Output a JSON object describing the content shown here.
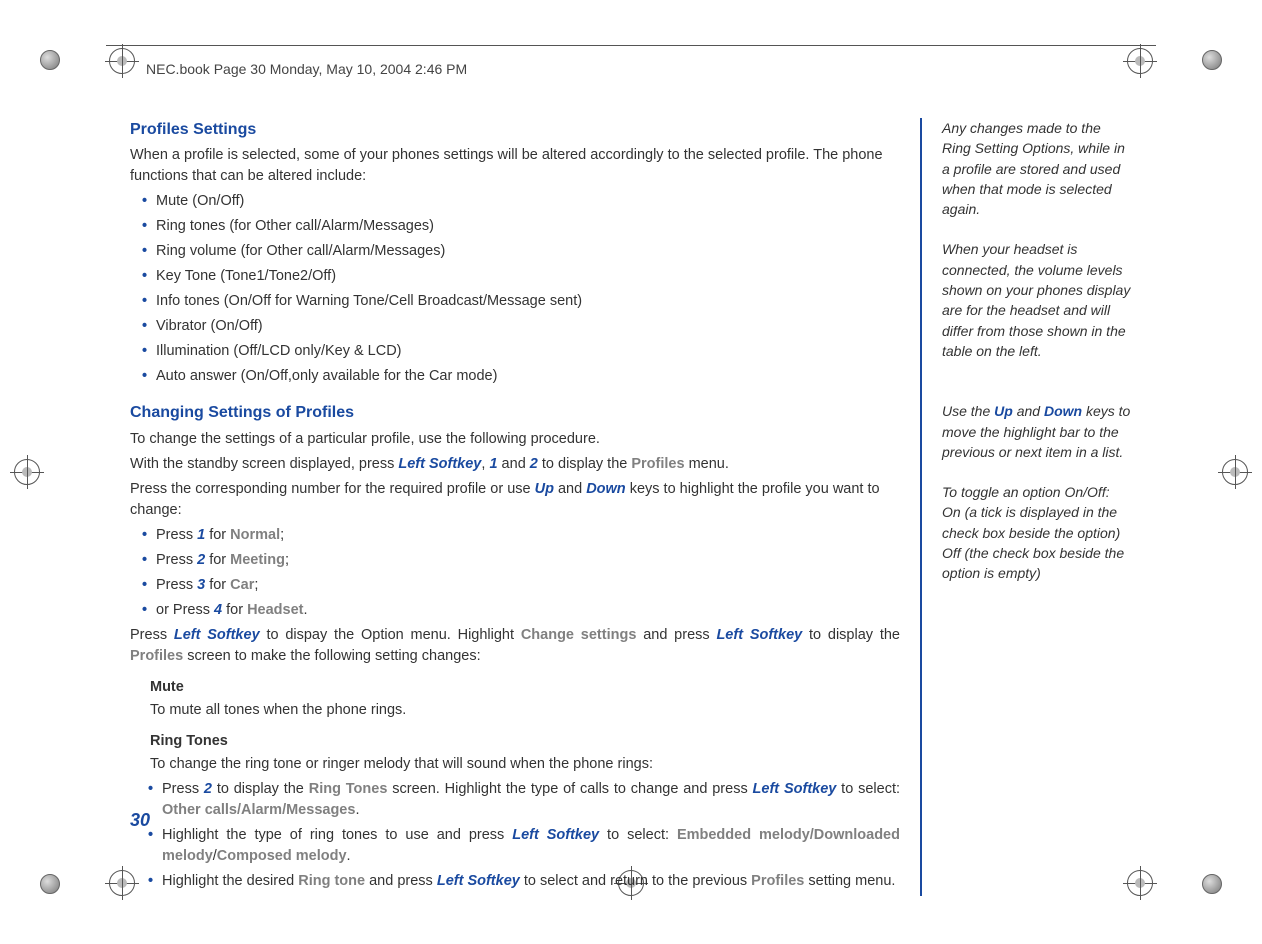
{
  "header": {
    "text": "NEC.book  Page 30  Monday, May 10, 2004  2:46 PM"
  },
  "page_number": "30",
  "main": {
    "h1": "Profiles Settings",
    "intro": "When a profile is selected, some of your phones settings will be altered accordingly to the selected profile. The phone functions that can be altered include:",
    "bullets1": [
      "Mute (On/Off)",
      "Ring tones (for Other call/Alarm/Messages)",
      "Ring volume (for Other call/Alarm/Messages)",
      "Key Tone (Tone1/Tone2/Off)",
      "Info tones (On/Off for Warning Tone/Cell Broadcast/Message sent)",
      "Vibrator (On/Off)",
      "Illumination (Off/LCD only/Key & LCD)",
      "Auto answer (On/Off,only available for the Car mode)"
    ],
    "h2": "Changing Settings of Profiles",
    "p1": "To change the settings of a particular profile, use the following procedure.",
    "p2_a": "With the standby screen displayed, press ",
    "p2_left_softkey": "Left Softkey",
    "p2_b": ", ",
    "p2_1": "1",
    "p2_c": " and ",
    "p2_2": "2",
    "p2_d": " to display the ",
    "p2_profiles": "Profiles",
    "p2_e": " menu.",
    "p3_a": "Press the corresponding number for the required profile or use ",
    "p3_up": "Up",
    "p3_b": " and ",
    "p3_down": "Down",
    "p3_c": " keys to highlight the profile you want to change:",
    "profile_items": {
      "b1_pre": "Press ",
      "b1_num": "1",
      "b1_mid": " for ",
      "b1_name": "Normal",
      "b1_end": ";",
      "b2_pre": "Press ",
      "b2_num": "2",
      "b2_mid": " for ",
      "b2_name": "Meeting",
      "b2_end": ";",
      "b3_pre": "Press ",
      "b3_num": "3",
      "b3_mid": " for ",
      "b3_name": "Car",
      "b3_end": ";",
      "b4_pre": "or Press ",
      "b4_num": "4",
      "b4_mid": " for ",
      "b4_name": "Headset",
      "b4_end": "."
    },
    "p4_a": "Press ",
    "p4_ls": "Left Softkey",
    "p4_b": " to dispay the Option menu. Highlight ",
    "p4_cs": "Change settings",
    "p4_c": " and press ",
    "p4_ls2": "Left Softkey",
    "p4_d": " to display the ",
    "p4_prof": "Profiles",
    "p4_e": " screen to make the following setting changes:",
    "mute_head": "Mute",
    "mute_body": "To mute all tones when the phone rings.",
    "rt_head": "Ring Tones",
    "rt_body": "To change the ring tone or ringer melody that will sound when the phone rings:",
    "rt_b1_a": "Press ",
    "rt_b1_2": "2",
    "rt_b1_b": " to display the ",
    "rt_b1_rt": "Ring Tones",
    "rt_b1_c": " screen. Highlight the type of calls to change and press ",
    "rt_b1_ls": "Left Softkey",
    "rt_b1_d": " to select: ",
    "rt_b1_sel": "Other calls/Alarm/Messages",
    "rt_b1_e": ".",
    "rt_b2_a": "Highlight the type of ring tones to use and press ",
    "rt_b2_ls": "Left Softkey",
    "rt_b2_b": " to select: ",
    "rt_b2_sel": "Embedded melody/Downloaded melody",
    "rt_b2_slash": "/",
    "rt_b2_sel2": "Composed melody",
    "rt_b2_e": ".",
    "rt_b3_a": "Highlight the desired ",
    "rt_b3_rt": "Ring tone",
    "rt_b3_b": " and press ",
    "rt_b3_ls": "Left Softkey",
    "rt_b3_c": " to select and return to the previous ",
    "rt_b3_prof": "Profiles",
    "rt_b3_d": " setting menu."
  },
  "side": {
    "n1": "Any changes made to the Ring Setting Options, while in a profile are stored and used when that mode is selected again.",
    "n2": "When your headset is connected, the volume levels shown on your phones display are for the headset and will differ from those shown in the table on the left.",
    "n3_a": "Use the ",
    "n3_up": "Up",
    "n3_b": " and ",
    "n3_down": "Down",
    "n3_c": " keys to move the highlight bar to the previous or next item in a list.",
    "n4": "To toggle an option On/Off: On (a tick is displayed in the check box beside the option) Off (the check box beside the option is empty)"
  }
}
